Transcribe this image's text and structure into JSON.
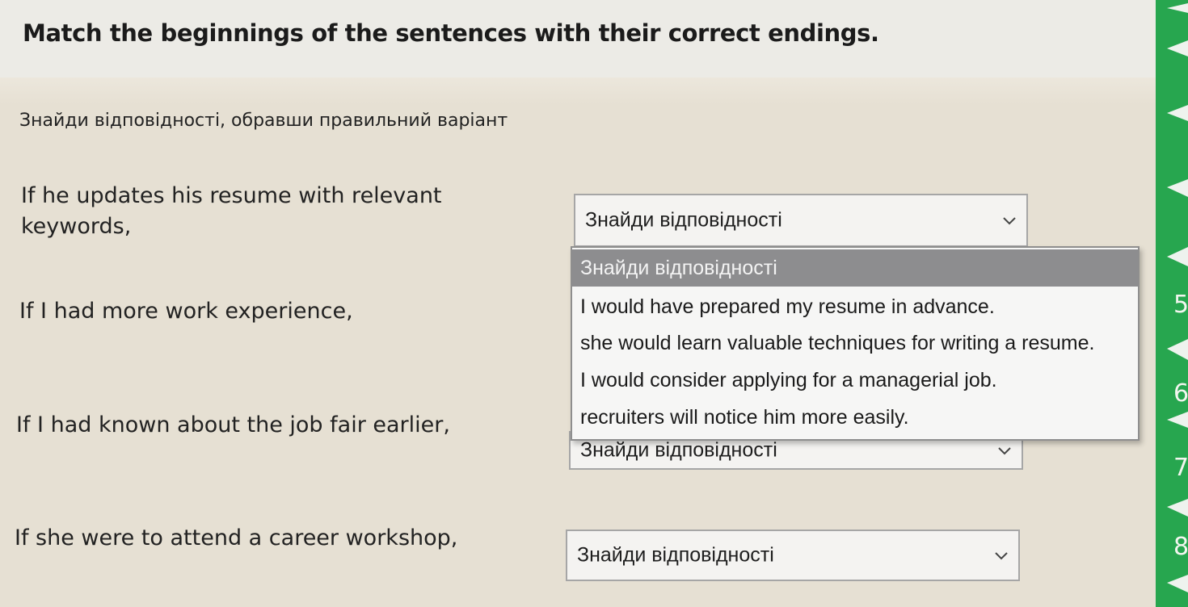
{
  "question": {
    "title": "Match the beginnings of the sentences with their correct endings.",
    "instruction": "Знайди відповідності, обравши правильний варіант"
  },
  "prompts": [
    {
      "line1": "If he updates his resume with relevant",
      "line2": "keywords,"
    },
    {
      "line1": "If I had more work experience,"
    },
    {
      "line1": "If I had known about the job fair earlier,"
    },
    {
      "line1": "If she were to attend a career workshop,"
    }
  ],
  "selects": [
    {
      "value": "Знайди відповідності",
      "state": "open"
    },
    {
      "value": "Знайди відповідності"
    },
    {
      "value": "Знайди відповідності"
    }
  ],
  "dropdown": {
    "options": [
      "Знайди відповідності",
      "I would have prepared my resume in advance.",
      "she would learn valuable techniques for writing a resume.",
      "I would consider applying for a managerial job.",
      "recruiters will notice him more easily."
    ],
    "highlighted_index": 0
  },
  "side_nav": {
    "visible_numbers": [
      "5",
      "6",
      "7",
      "8"
    ]
  },
  "colors": {
    "page_bg": "#e6e0d3",
    "header_bg": "#ecebe6",
    "side_strip": "#27a64f",
    "highlight": "#8d8d8f"
  }
}
